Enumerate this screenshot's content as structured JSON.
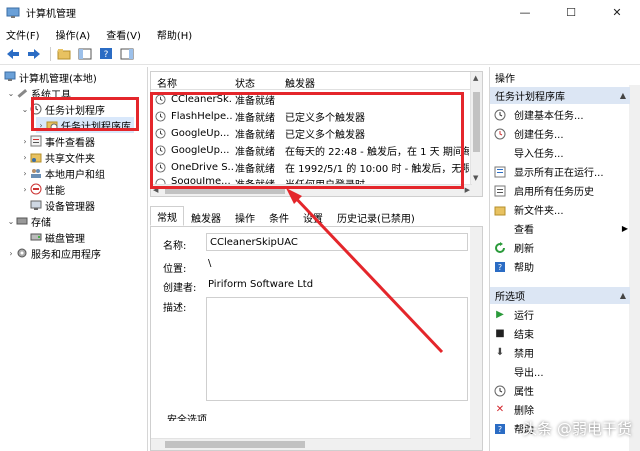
{
  "window": {
    "title": "计算机管理",
    "controls": [
      "—",
      "☐",
      "✕"
    ]
  },
  "menu": [
    "文件(F)",
    "操作(A)",
    "查看(V)",
    "帮助(H)"
  ],
  "tree": {
    "root": "计算机管理(本地)",
    "system_tools": "系统工具",
    "task_scheduler": "任务计划程序",
    "task_library": "任务计划程序库",
    "event_viewer": "事件查看器",
    "shared_folders": "共享文件夹",
    "local_users": "本地用户和组",
    "performance": "性能",
    "device_manager": "设备管理器",
    "storage": "存储",
    "disk_management": "磁盘管理",
    "services": "服务和应用程序"
  },
  "task_list": {
    "columns": [
      "名称",
      "状态",
      "触发器"
    ],
    "rows": [
      {
        "name": "CCleanerSk...",
        "status": "准备就绪",
        "trigger": ""
      },
      {
        "name": "FlashHelpe...",
        "status": "准备就绪",
        "trigger": "已定义多个触发器"
      },
      {
        "name": "GoogleUp...",
        "status": "准备就绪",
        "trigger": "已定义多个触发器"
      },
      {
        "name": "GoogleUp...",
        "status": "准备就绪",
        "trigger": "在每天的 22:48 - 触发后，在 1 天 期间每"
      },
      {
        "name": "OneDrive S...",
        "status": "准备就绪",
        "trigger": "在 1992/5/1 的 10:00 时 - 触发后，无限期"
      },
      {
        "name": "SogouIme...",
        "status": "准备就绪",
        "trigger": "当任何用户登录时"
      }
    ]
  },
  "tabs": [
    "常规",
    "触发器",
    "操作",
    "条件",
    "设置",
    "历史记录(已禁用)"
  ],
  "details": {
    "name_label": "名称:",
    "name_value": "CCleanerSkipUAC",
    "location_label": "位置:",
    "location_value": "\\",
    "author_label": "创建者:",
    "author_value": "Piriform Software Ltd",
    "desc_label": "描述:",
    "security_label": "安全选项"
  },
  "actions": {
    "header": "操作",
    "section1": "任务计划程序库",
    "items1": [
      "创建基本任务...",
      "创建任务...",
      "导入任务...",
      "显示所有正在运行...",
      "启用所有任务历史",
      "新文件夹...",
      "查看",
      "刷新",
      "帮助"
    ],
    "section2": "所选项",
    "items2": [
      "运行",
      "结束",
      "禁用",
      "导出...",
      "属性",
      "删除",
      "帮助"
    ]
  },
  "watermark": "头条 @弱电干货",
  "colors": {
    "highlight": "#e4262b",
    "section_bg": "#dce6f4",
    "accent": "#0078d7"
  }
}
